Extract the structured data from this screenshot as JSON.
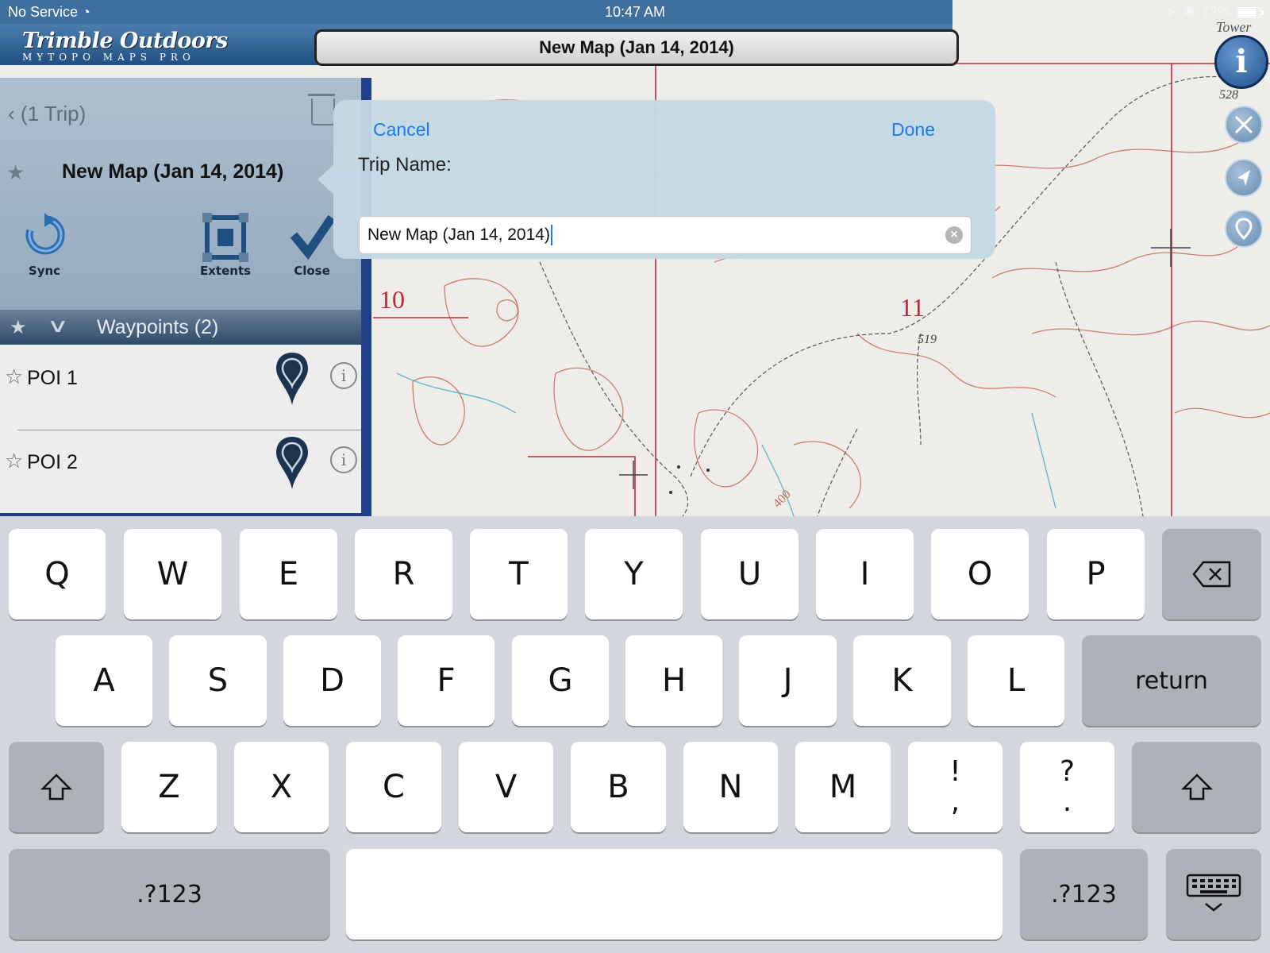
{
  "status_bar": {
    "carrier": "No Service",
    "time": "10:47 AM",
    "battery": "77%",
    "battery_level": 0.77
  },
  "app": {
    "logo_line1": "Trimble Outdoors",
    "logo_line2": "MYTOPO MAPS PRO",
    "map_title": "New Map (Jan 14, 2014)",
    "info_button": "i"
  },
  "map": {
    "labels": [
      "10",
      "11",
      "519",
      "528",
      "400",
      "Tower"
    ]
  },
  "panel": {
    "back_label": "(1 Trip)",
    "trip_name": "New Map (Jan 14, 2014)",
    "tools": {
      "sync": "Sync",
      "extents": "Extents",
      "close": "Close"
    },
    "waypoints_header": "Waypoints (2)",
    "waypoints": [
      {
        "label": "POI 1"
      },
      {
        "label": "POI 2"
      }
    ]
  },
  "popover": {
    "cancel": "Cancel",
    "done": "Done",
    "field_label": "Trip Name:",
    "field_value": "New Map (Jan 14, 2014)"
  },
  "keyboard": {
    "row1": [
      "Q",
      "W",
      "E",
      "R",
      "T",
      "Y",
      "U",
      "I",
      "O",
      "P"
    ],
    "row2": [
      "A",
      "S",
      "D",
      "F",
      "G",
      "H",
      "J",
      "K",
      "L"
    ],
    "row3": [
      "Z",
      "X",
      "C",
      "V",
      "B",
      "N",
      "M"
    ],
    "return": "return",
    "numbers": ".?123",
    "punct1_top": "!",
    "punct1_bottom": ",",
    "punct2_top": "?",
    "punct2_bottom": "."
  },
  "colors": {
    "accent_blue": "#1a7af0",
    "header_blue": "#2a5a8a",
    "map_contour": "#c05a4a",
    "map_red_line": "#c0283a"
  }
}
